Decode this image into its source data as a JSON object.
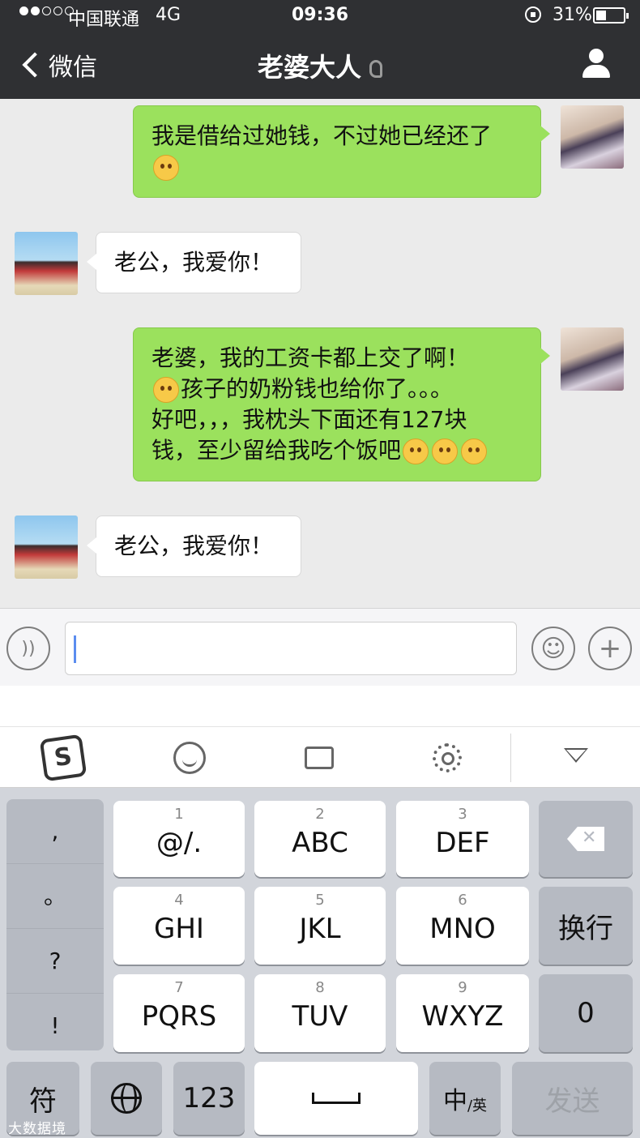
{
  "status_bar": {
    "carrier": "中国联通",
    "network": "4G",
    "time": "09:36",
    "battery_percent": "31%",
    "battery_level": 0.31,
    "signal_bars_filled": 2,
    "signal_bars_total": 5
  },
  "nav": {
    "back_label": "微信",
    "title": "老婆大人"
  },
  "messages": [
    {
      "sender": "me",
      "text": "我是借给过她钱，不过她已经还了",
      "emoji_count": 1
    },
    {
      "sender": "her",
      "text": "老公，我爱你！"
    },
    {
      "sender": "me",
      "line1": "老婆，我的工资卡都上交了啊！",
      "line2": "孩子的奶粉钱也给你了。。。",
      "line3": "好吧，，，我枕头下面还有127块",
      "line4": "钱，至少留给我吃个饭吧",
      "emoji_count": 4
    },
    {
      "sender": "her",
      "text": "老公，我爱你！"
    }
  ],
  "input": {
    "value": ""
  },
  "keyboard": {
    "punctuation": [
      ",",
      "。",
      "?",
      "!"
    ],
    "keys": [
      {
        "num": "1",
        "label": "@/."
      },
      {
        "num": "2",
        "label": "ABC"
      },
      {
        "num": "3",
        "label": "DEF"
      },
      {
        "num": "4",
        "label": "GHI"
      },
      {
        "num": "5",
        "label": "JKL"
      },
      {
        "num": "6",
        "label": "MNO"
      },
      {
        "num": "7",
        "label": "PQRS"
      },
      {
        "num": "8",
        "label": "TUV"
      },
      {
        "num": "9",
        "label": "WXYZ"
      }
    ],
    "return_label": "换行",
    "zero_label": "0",
    "symbols_label": "符",
    "numbers_label": "123",
    "lang_main": "中",
    "lang_sub": "/英",
    "send_label": "发送"
  },
  "watermark": "大数据境",
  "colors": {
    "nav_bg": "#2f3033",
    "my_bubble": "#9be15d",
    "their_bubble": "#ffffff",
    "chat_bg": "#ebebeb"
  }
}
